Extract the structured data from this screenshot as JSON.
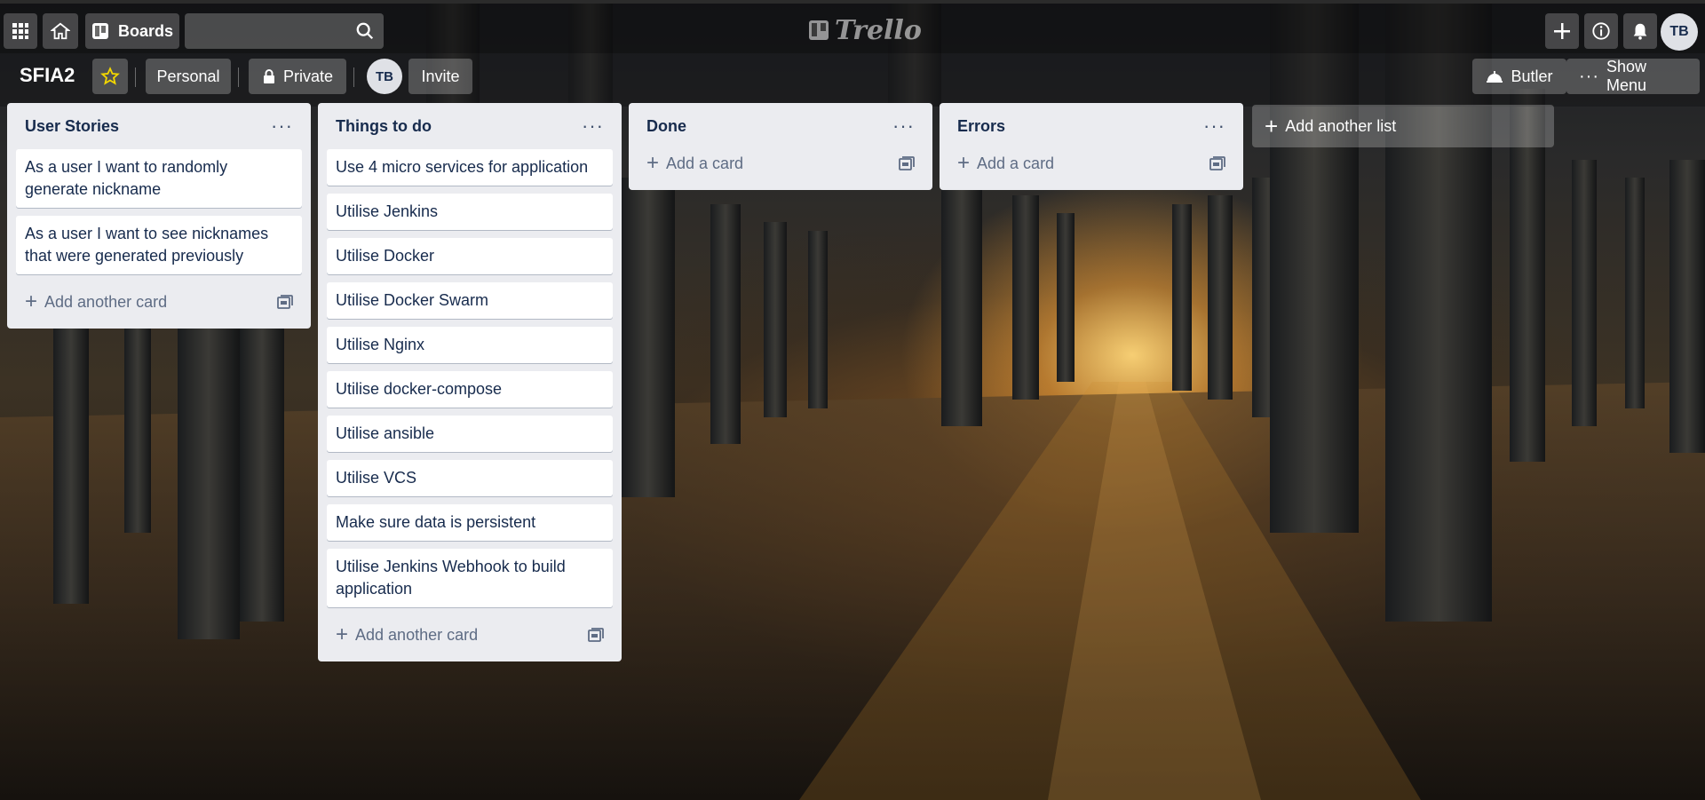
{
  "topbar": {
    "apps_icon": "apps-grid-icon",
    "home_icon": "home-icon",
    "boards_label": "Boards",
    "search_placeholder": "",
    "logo_text": "Trello",
    "avatar_initials": "TB"
  },
  "board": {
    "title": "SFIA2",
    "team_label": "Personal",
    "visibility_label": "Private",
    "member_initials": "TB",
    "invite_label": "Invite",
    "butler_label": "Butler",
    "show_menu_label": "Show Menu"
  },
  "lists": [
    {
      "title": "User Stories",
      "cards": [
        "As a user I want to randomly generate nickname",
        "As a user I want to see nicknames that were generated previously"
      ],
      "add_label": "Add another card"
    },
    {
      "title": "Things to do",
      "cards": [
        "Use 4 micro services for application",
        "Utilise Jenkins",
        "Utilise Docker",
        "Utilise Docker Swarm",
        "Utilise Nginx",
        "Utilise docker-compose",
        "Utilise ansible",
        "Utilise VCS",
        "Make sure data is persistent",
        "Utilise Jenkins Webhook to build application"
      ],
      "add_label": "Add another card"
    },
    {
      "title": "Done",
      "cards": [],
      "add_label": "Add a card"
    },
    {
      "title": "Errors",
      "cards": [],
      "add_label": "Add a card"
    }
  ],
  "add_list_label": "Add another list",
  "colors": {
    "list_bg": "#ebecf0",
    "card_text": "#172b4d",
    "star": "#f2d600"
  }
}
